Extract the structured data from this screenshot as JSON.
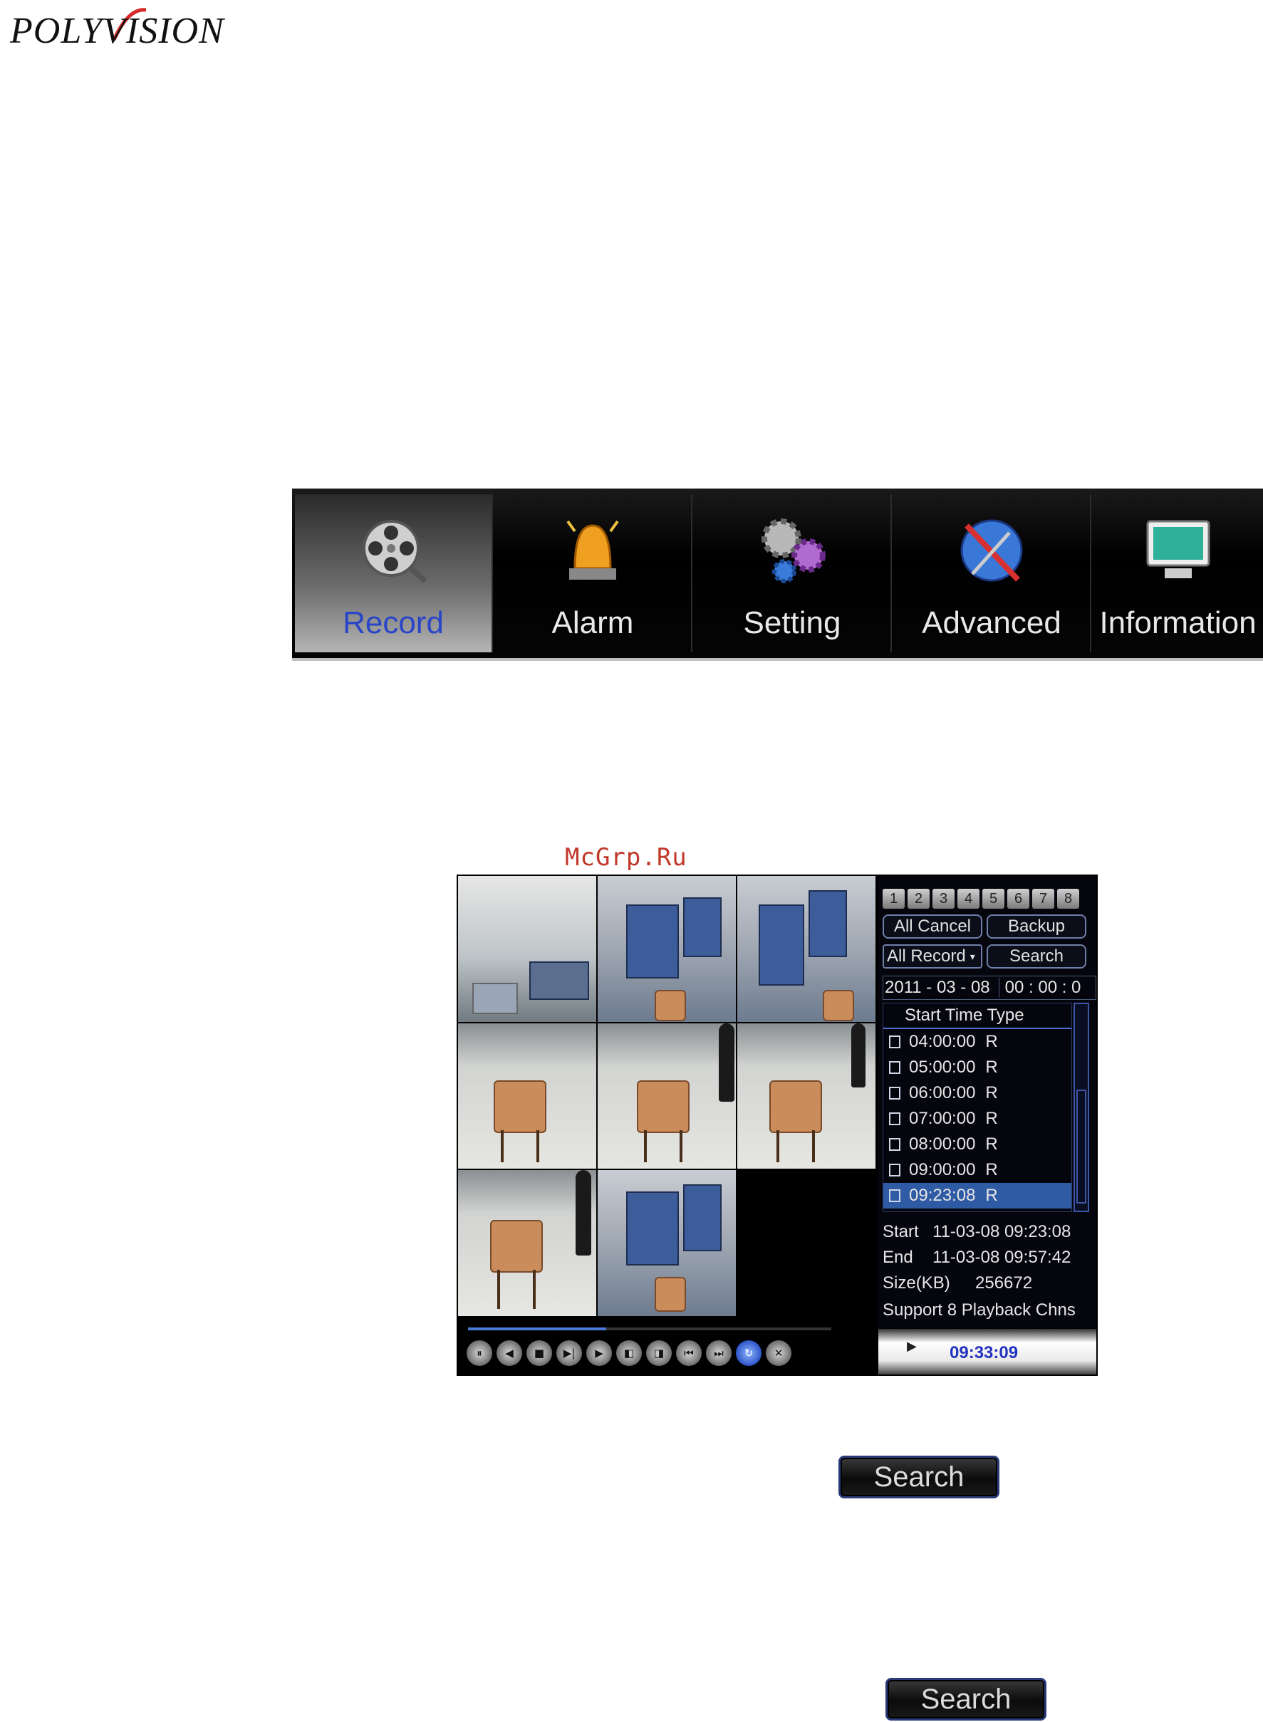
{
  "brand": {
    "logo_text": "POLYVISION"
  },
  "menu": {
    "items": [
      {
        "label": "Record",
        "icon": "film-reel-icon",
        "active": true
      },
      {
        "label": "Alarm",
        "icon": "alarm-siren-icon",
        "active": false
      },
      {
        "label": "Setting",
        "icon": "gears-icon",
        "active": false
      },
      {
        "label": "Advanced",
        "icon": "tools-globe-icon",
        "active": false
      },
      {
        "label": "Information",
        "icon": "monitor-icon",
        "active": false
      }
    ],
    "active_color": "#2a46c8"
  },
  "watermark": "McGrp.Ru",
  "playback": {
    "channels": [
      "1",
      "2",
      "3",
      "4",
      "5",
      "6",
      "7",
      "8"
    ],
    "buttons": {
      "all_cancel": "All Cancel",
      "backup": "Backup",
      "record_type": "All Record",
      "search": "Search"
    },
    "date": "2011  - 03 - 08",
    "time": "00 :  00 :  0",
    "list_header": "Start Time Type",
    "records": [
      {
        "time": "04:00:00",
        "type": "R",
        "selected": false
      },
      {
        "time": "05:00:00",
        "type": "R",
        "selected": false
      },
      {
        "time": "06:00:00",
        "type": "R",
        "selected": false
      },
      {
        "time": "07:00:00",
        "type": "R",
        "selected": false
      },
      {
        "time": "08:00:00",
        "type": "R",
        "selected": false
      },
      {
        "time": "09:00:00",
        "type": "R",
        "selected": false
      },
      {
        "time": "09:23:08",
        "type": "R",
        "selected": true
      }
    ],
    "details": {
      "start_label": "Start",
      "start_value": "11-03-08 09:23:08",
      "end_label": "End",
      "end_value": "11-03-08 09:57:42",
      "size_label": "Size(KB)",
      "size_value": "256672",
      "support": "Support 8 Playback Chns"
    },
    "current_time": "09:33:09",
    "progress": 0.38,
    "controls": [
      {
        "icon": "pause-icon",
        "glyph": "⏸"
      },
      {
        "icon": "rewind-icon",
        "glyph": "◀"
      },
      {
        "icon": "stop-icon",
        "glyph": "■"
      },
      {
        "icon": "step-forward-icon",
        "glyph": "▶|"
      },
      {
        "icon": "play-icon",
        "glyph": "▶"
      },
      {
        "icon": "slow-icon",
        "glyph": "◧"
      },
      {
        "icon": "fast-icon",
        "glyph": "◨"
      },
      {
        "icon": "previous-icon",
        "glyph": "⏮"
      },
      {
        "icon": "next-icon",
        "glyph": "⏭"
      },
      {
        "icon": "repeat-icon",
        "glyph": "↻"
      },
      {
        "icon": "close-icon",
        "glyph": "✕"
      }
    ]
  },
  "search_buttons": [
    "Search",
    "Search"
  ]
}
